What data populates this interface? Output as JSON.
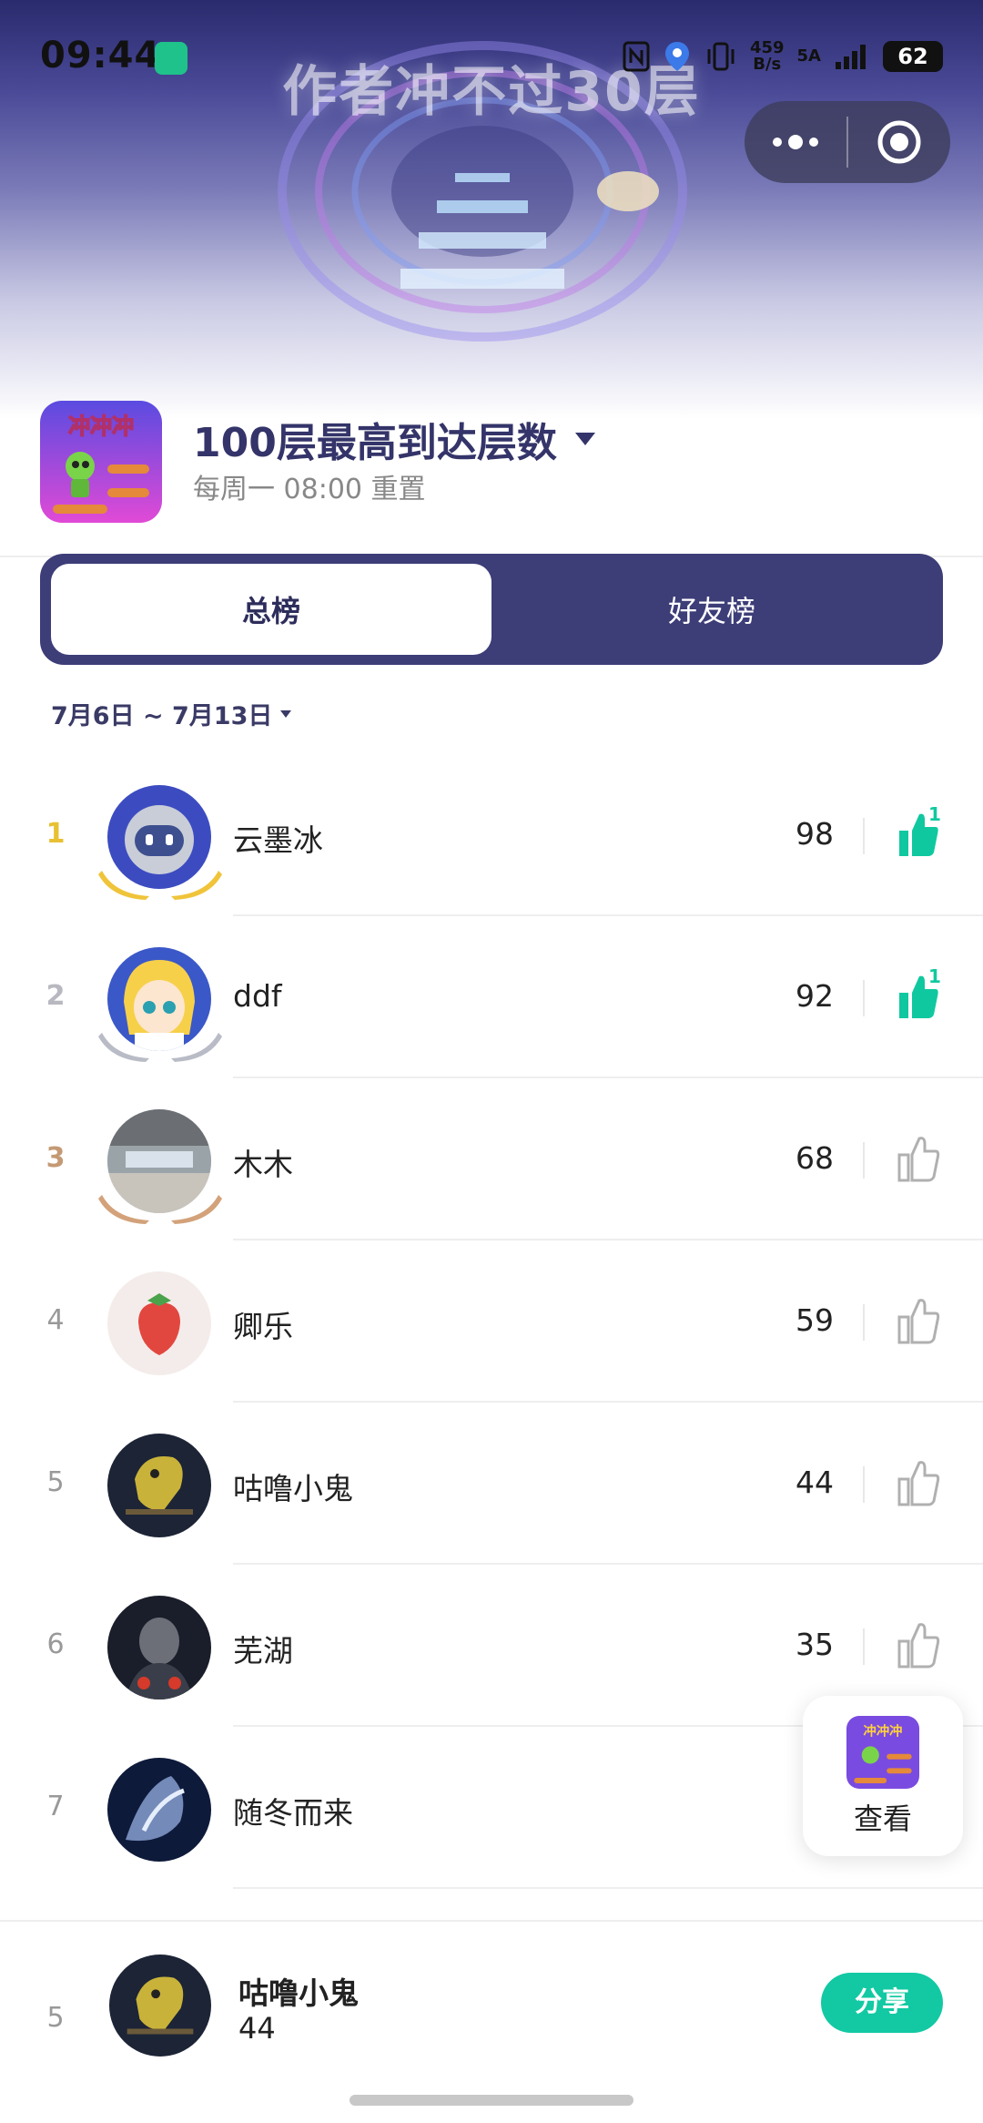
{
  "status_bar": {
    "time": "09:44",
    "speed_top": "459",
    "speed_bottom": "B/s",
    "network": "5A",
    "battery": "62"
  },
  "banner": {
    "title": "作者冲不过30层"
  },
  "header": {
    "icon_text": "冲冲冲",
    "title": "100层最高到达层数",
    "subtitle": "每周一 08:00 重置"
  },
  "tabs": [
    {
      "label": "总榜",
      "active": true
    },
    {
      "label": "好友榜",
      "active": false
    }
  ],
  "date_range": "7月6日 ~ 7月13日",
  "ranking": [
    {
      "rank": "1",
      "name": "云墨冰",
      "score": "98",
      "liked": true,
      "like_count": "1"
    },
    {
      "rank": "2",
      "name": "ddf",
      "score": "92",
      "liked": true,
      "like_count": "1"
    },
    {
      "rank": "3",
      "name": "木木",
      "score": "68",
      "liked": false,
      "like_count": ""
    },
    {
      "rank": "4",
      "name": "卿乐",
      "score": "59",
      "liked": false,
      "like_count": ""
    },
    {
      "rank": "5",
      "name": "咕噜小鬼",
      "score": "44",
      "liked": false,
      "like_count": ""
    },
    {
      "rank": "6",
      "name": "芜湖",
      "score": "35",
      "liked": false,
      "like_count": ""
    },
    {
      "rank": "7",
      "name": "随冬而来",
      "score": "",
      "liked": false,
      "like_count": ""
    }
  ],
  "float_card": {
    "label": "查看"
  },
  "me": {
    "rank": "5",
    "name": "咕噜小鬼",
    "score": "44",
    "share_label": "分享"
  },
  "colors": {
    "accent": "#12c9a3",
    "tab_bg": "#3d3d78",
    "title": "#34346a"
  }
}
